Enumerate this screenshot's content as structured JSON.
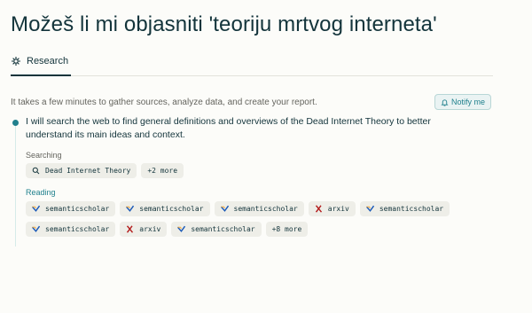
{
  "page": {
    "title": "Možeš li mi objasniti 'teoriju mrtvog interneta'"
  },
  "tabs": [
    {
      "label": "Research",
      "icon": "research-icon"
    }
  ],
  "info": {
    "text": "It takes a few minutes to gather sources, analyze data, and create your report.",
    "notify_label": "Notify me"
  },
  "step": {
    "text": "I will search the web to find general definitions and overviews of the Dead Internet Theory to better understand its main ideas and context.",
    "searching_label": "Searching",
    "search_chips": [
      {
        "label": "Dead Internet Theory",
        "icon": "search-icon"
      },
      {
        "label": "+2 more"
      }
    ],
    "reading_label": "Reading",
    "reading_rows": [
      [
        {
          "label": "semanticscholar",
          "icon": "semanticscholar-icon"
        },
        {
          "label": "semanticscholar",
          "icon": "semanticscholar-icon"
        },
        {
          "label": "semanticscholar",
          "icon": "semanticscholar-icon"
        },
        {
          "label": "arxiv",
          "icon": "arxiv-icon"
        },
        {
          "label": "semanticscholar",
          "icon": "semanticscholar-icon"
        }
      ],
      [
        {
          "label": "semanticscholar",
          "icon": "semanticscholar-icon"
        },
        {
          "label": "arxiv",
          "icon": "arxiv-icon"
        },
        {
          "label": "semanticscholar",
          "icon": "semanticscholar-icon"
        },
        {
          "label": "+8 more"
        }
      ]
    ]
  },
  "colors": {
    "accent": "#20808d",
    "text": "#13343b",
    "muted": "#64645e",
    "chip": "#eeeee8",
    "arxiv": "#b31b1b"
  }
}
